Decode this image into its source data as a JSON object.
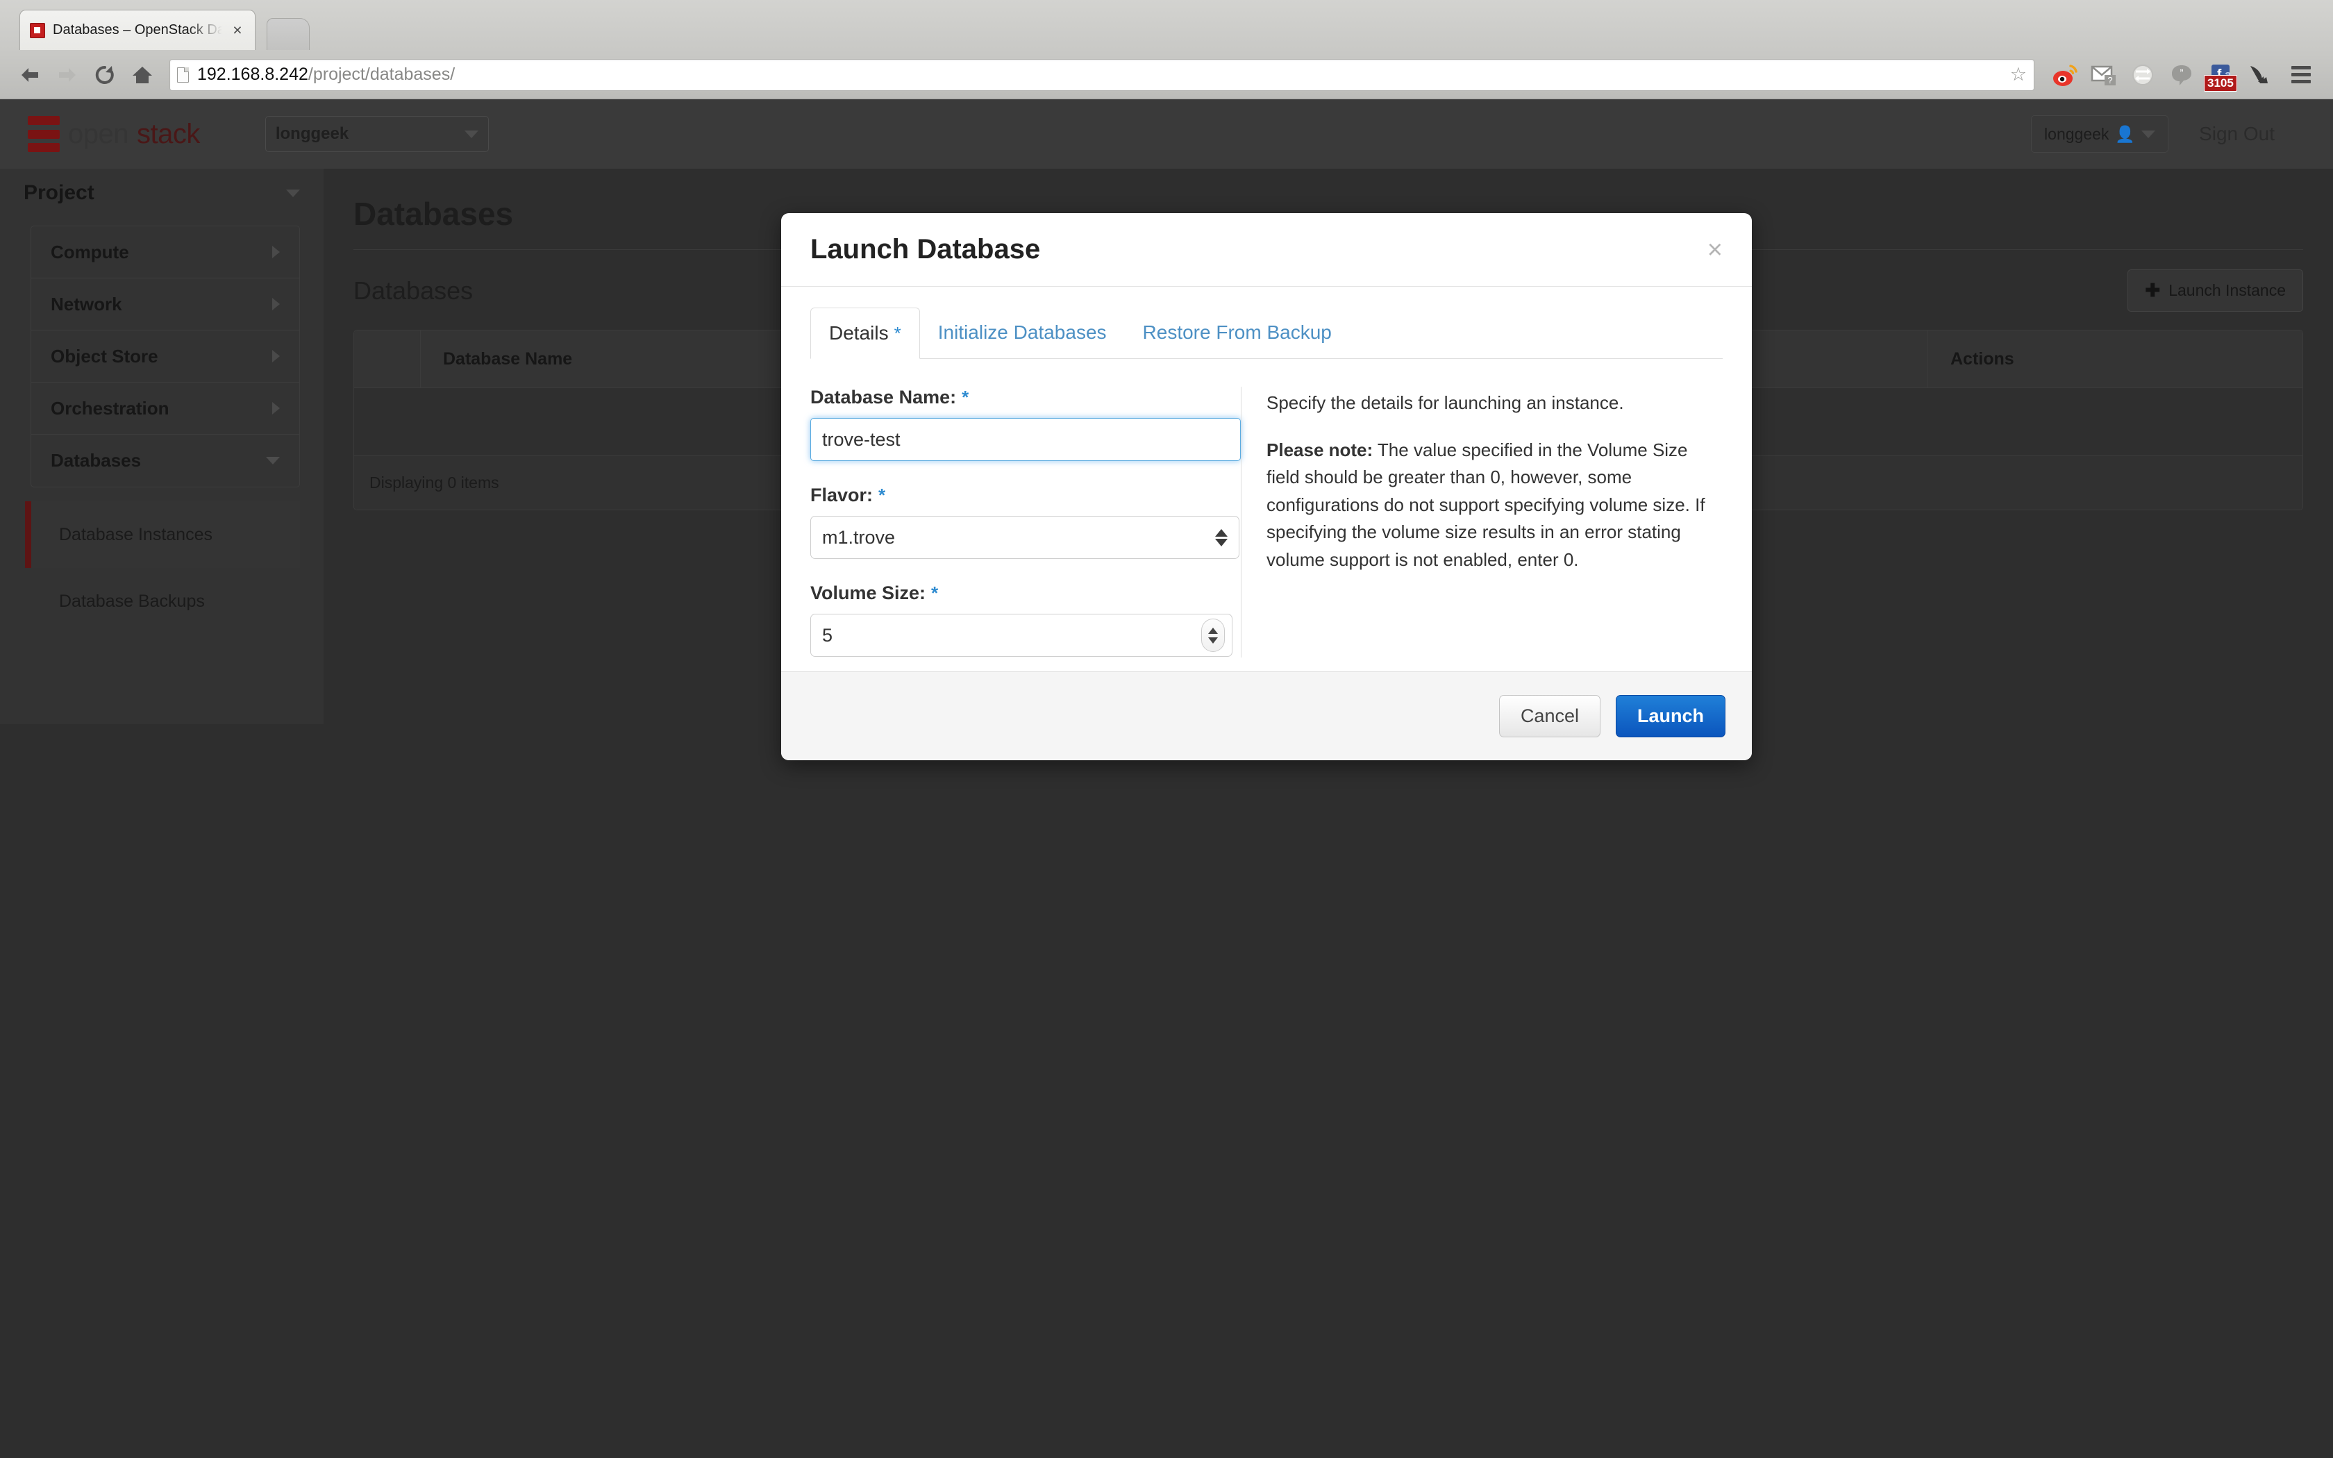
{
  "browser": {
    "tab_title": "Databases – OpenStack Da",
    "tab_close_label": "×",
    "url_host": "192.168.8.242",
    "url_path": "/project/databases/",
    "back_icon": "back-arrow-icon",
    "forward_icon": "forward-arrow-icon",
    "reload_icon": "reload-icon",
    "home_icon": "home-icon",
    "star_label": "☆",
    "extensions": [
      {
        "name": "weibo-extension-icon",
        "badge": ""
      },
      {
        "name": "gmail-checker-icon",
        "badge": ""
      },
      {
        "name": "sync-globe-icon",
        "badge": ""
      },
      {
        "name": "hangouts-icon",
        "badge": ""
      },
      {
        "name": "facebook-notifications-icon",
        "badge": "3105"
      },
      {
        "name": "download-shortcut-icon",
        "badge": ""
      }
    ],
    "menu_icon": "hamburger-menu-icon"
  },
  "header": {
    "logo_open": "open",
    "logo_stack": "stack",
    "project_selector": "longgeek",
    "user_menu": "longgeek",
    "sign_out": "Sign Out"
  },
  "sidebar": {
    "heading": "Project",
    "items": [
      {
        "label": "Compute",
        "expanded": false
      },
      {
        "label": "Network",
        "expanded": false
      },
      {
        "label": "Object Store",
        "expanded": false
      },
      {
        "label": "Orchestration",
        "expanded": false
      },
      {
        "label": "Databases",
        "expanded": true
      }
    ],
    "subitems": [
      {
        "label": "Database Instances",
        "active": true
      },
      {
        "label": "Database Backups",
        "active": false
      }
    ]
  },
  "content": {
    "page_title": "Databases",
    "panel_title": "Databases",
    "launch_instance_button": "Launch Instance",
    "plus_glyph": "✚",
    "table": {
      "columns": [
        "Database Name",
        "Actions"
      ],
      "rows": [],
      "footer": "Displaying 0 items"
    }
  },
  "modal": {
    "title": "Launch Database",
    "close_label": "×",
    "tabs": [
      {
        "label": "Details",
        "required": true,
        "active": true
      },
      {
        "label": "Initialize Databases",
        "required": false,
        "active": false
      },
      {
        "label": "Restore From Backup",
        "required": false,
        "active": false
      }
    ],
    "required_marker": "*",
    "fields": {
      "database_name": {
        "label": "Database Name:",
        "value": "trove-test",
        "placeholder": "",
        "required": true
      },
      "flavor": {
        "label": "Flavor:",
        "value": "m1.trove",
        "required": true
      },
      "volume_size": {
        "label": "Volume Size:",
        "value": "5",
        "required": true
      }
    },
    "help": {
      "intro": "Specify the details for launching an instance.",
      "note_lead": "Please note:",
      "note_body": " The value specified in the Volume Size field should be greater than 0, however, some configurations do not support specifying volume size. If specifying the volume size results in an error stating volume support is not enabled, enter 0."
    },
    "cancel_button": "Cancel",
    "launch_button": "Launch"
  },
  "colors": {
    "accent_blue": "#2e8bd0",
    "primary_button": "#0b55bd",
    "brand_red": "#a52121",
    "badge_red": "#b01a1a"
  }
}
